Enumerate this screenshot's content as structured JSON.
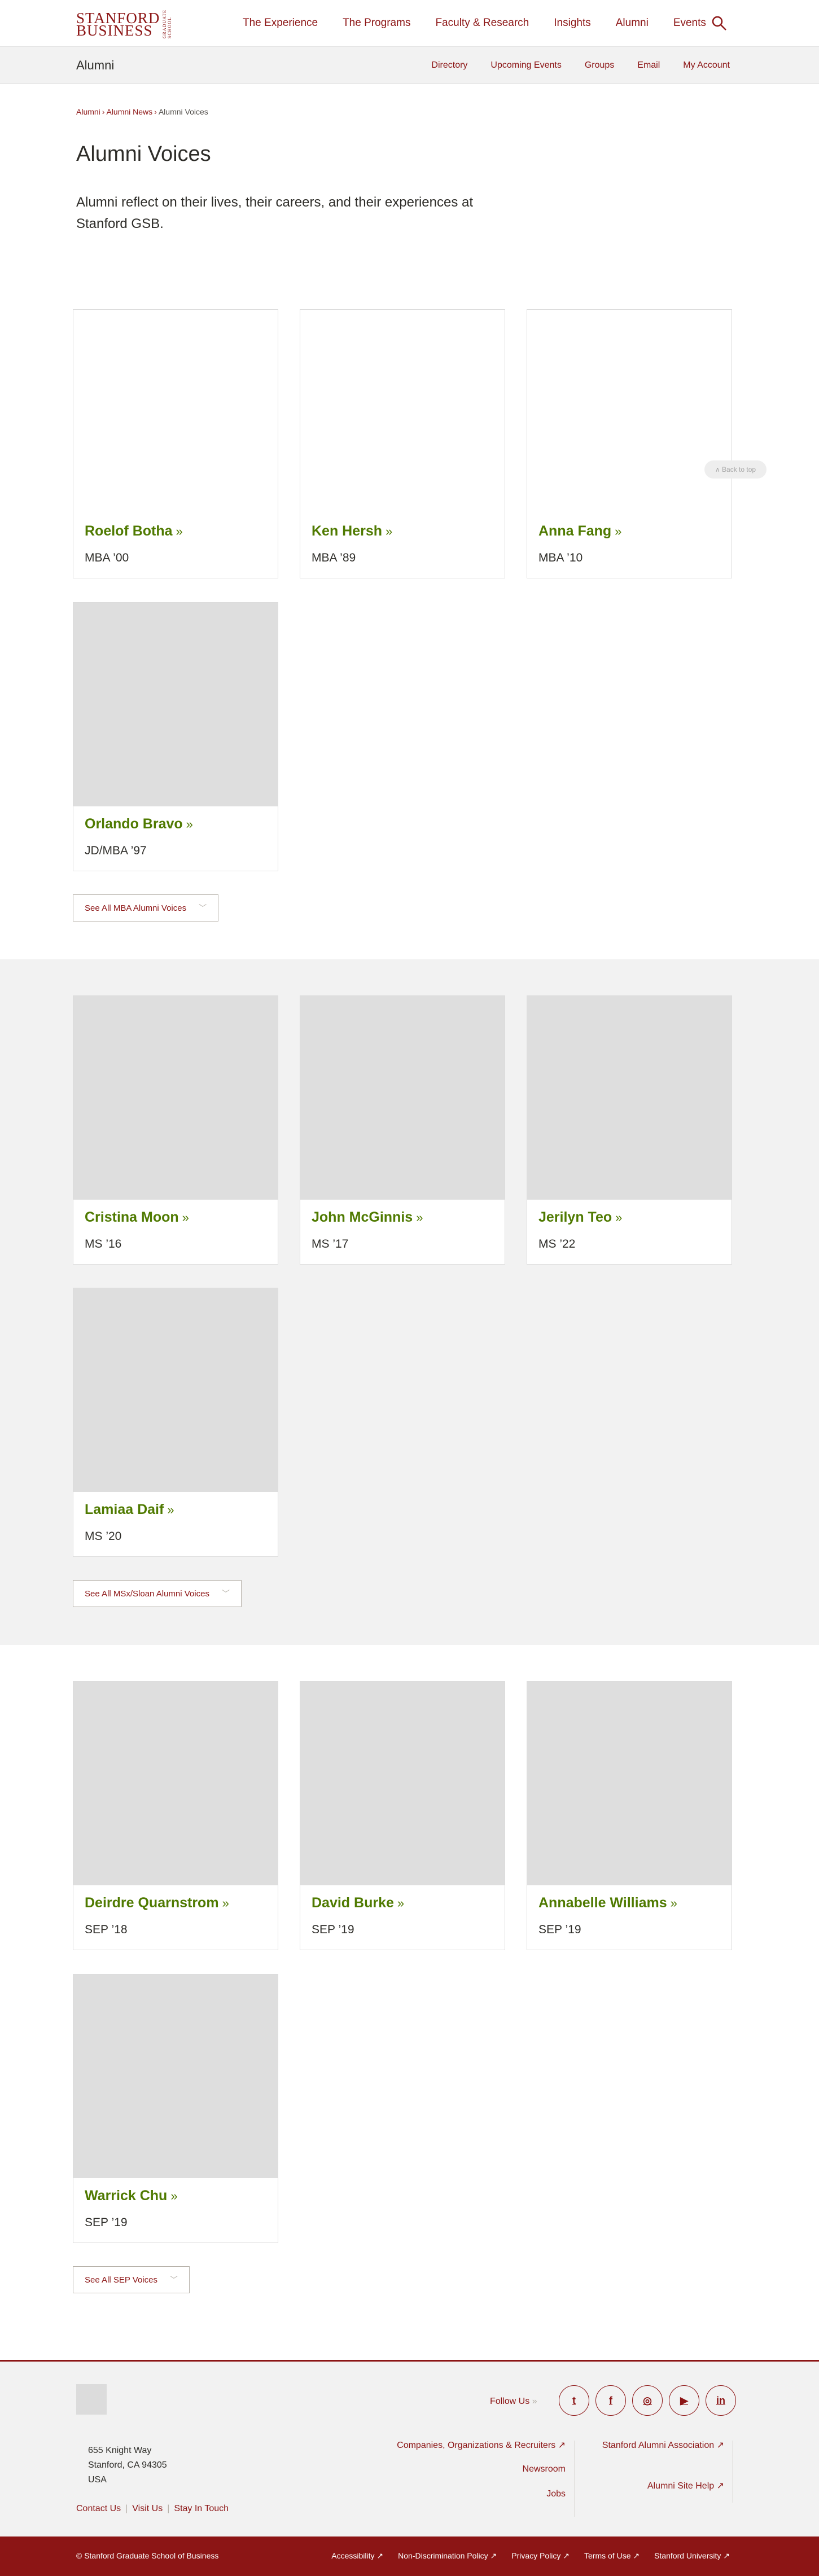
{
  "header": {
    "logo_text": "STANFORD BUSINESS",
    "logo_side": "GRADUATE SCHOOL",
    "nav": [
      "The Experience",
      "The Programs",
      "Faculty & Research",
      "Insights",
      "Alumni",
      "Events"
    ]
  },
  "subnav": {
    "title": "Alumni",
    "links": [
      "Directory",
      "Upcoming Events",
      "Groups",
      "Email",
      "My Account"
    ]
  },
  "breadcrumb": [
    "Alumni",
    "Alumni News",
    "Alumni Voices"
  ],
  "page": {
    "title": "Alumni Voices",
    "intro": "Alumni reflect on their lives, their careers, and their experiences at Stanford GSB.",
    "back_to_top": "Back to top"
  },
  "sections": [
    {
      "cards": [
        {
          "name": "Roelof Botha",
          "degree": "MBA ’00"
        },
        {
          "name": "Ken Hersh",
          "degree": "MBA ’89"
        },
        {
          "name": "Anna Fang",
          "degree": "MBA ’10"
        },
        {
          "name": "Orlando Bravo",
          "degree": "JD/MBA ’97"
        }
      ],
      "see_all": "See All MBA Alumni Voices"
    },
    {
      "cards": [
        {
          "name": "Cristina Moon",
          "degree": "MS ’16"
        },
        {
          "name": "John McGinnis",
          "degree": "MS ’17"
        },
        {
          "name": "Jerilyn Teo",
          "degree": "MS ’22"
        },
        {
          "name": "Lamiaa Daif",
          "degree": "MS ’20"
        }
      ],
      "see_all": "See All MSx/Sloan Alumni Voices"
    },
    {
      "cards": [
        {
          "name": "Deirdre Quarnstrom",
          "degree": "SEP ’18"
        },
        {
          "name": "David Burke",
          "degree": "SEP ’19"
        },
        {
          "name": "Annabelle Williams",
          "degree": "SEP ’19"
        },
        {
          "name": "Warrick Chu",
          "degree": "SEP ’19"
        }
      ],
      "see_all": "See All SEP Voices"
    }
  ],
  "footer": {
    "follow_us": "Follow Us",
    "social": [
      {
        "icon": "twitter-icon",
        "glyph": "t"
      },
      {
        "icon": "facebook-icon",
        "glyph": "f"
      },
      {
        "icon": "instagram-icon",
        "glyph": "◎"
      },
      {
        "icon": "youtube-icon",
        "glyph": "▶"
      },
      {
        "icon": "linkedin-icon",
        "glyph": "in"
      }
    ],
    "address": [
      "655 Knight Way",
      "Stanford, CA 94305",
      "USA"
    ],
    "links": [
      "Contact Us",
      "Visit Us",
      "Stay In Touch"
    ],
    "col1": [
      "Companies, Organizations & Recruiters ↗",
      "Newsroom",
      "Jobs"
    ],
    "col2": [
      "Stanford Alumni Association ↗",
      "Alumni Site Help ↗"
    ]
  },
  "bottom_bar": {
    "copyright": "© Stanford Graduate School of Business",
    "links": [
      "Accessibility ↗",
      "Non-Discrimination Policy ↗",
      "Privacy Policy ↗",
      "Terms of Use ↗",
      "Stanford University ↗"
    ]
  },
  "colors": {
    "brand": "#8c1515",
    "accent_green": "#4f7a01",
    "gray_bg": "#f2f2f2"
  }
}
